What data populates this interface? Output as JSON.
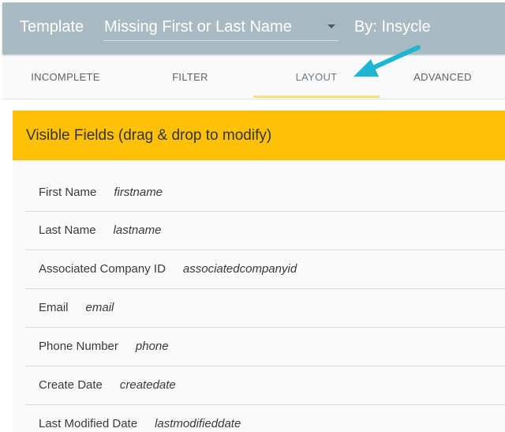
{
  "header": {
    "label": "Template",
    "template_value": "Missing First or Last Name",
    "author": "By: Insycle"
  },
  "tabs": [
    {
      "label": "INCOMPLETE",
      "active": false
    },
    {
      "label": "FILTER",
      "active": false
    },
    {
      "label": "LAYOUT",
      "active": true
    },
    {
      "label": "ADVANCED",
      "active": false
    }
  ],
  "section": {
    "title": "Visible Fields (drag & drop to modify)"
  },
  "fields": [
    {
      "label": "First Name",
      "key": "firstname"
    },
    {
      "label": "Last Name",
      "key": "lastname"
    },
    {
      "label": "Associated Company ID",
      "key": "associatedcompanyid"
    },
    {
      "label": "Email",
      "key": "email"
    },
    {
      "label": "Phone Number",
      "key": "phone"
    },
    {
      "label": "Create Date",
      "key": "createdate"
    },
    {
      "label": "Last Modified Date",
      "key": "lastmodifieddate"
    }
  ],
  "colors": {
    "header_bg": "#a9bac3",
    "section_header_bg": "#ffc107",
    "tab_ink": "#f1e38a",
    "arrow": "#1fb6d3"
  },
  "icons": {
    "dropdown": "caret-down-icon",
    "annotation": "pointer-arrow-icon"
  }
}
